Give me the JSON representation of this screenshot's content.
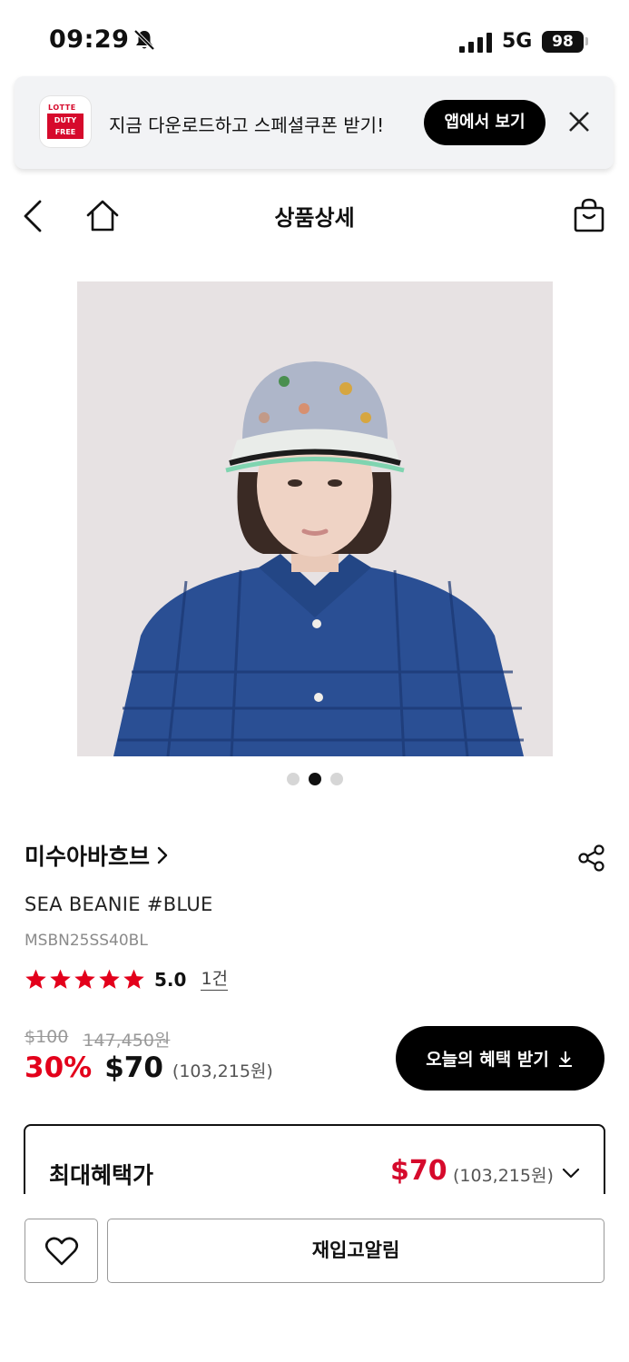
{
  "status_bar": {
    "time": "09:29",
    "network": "5G",
    "battery": "98"
  },
  "app_banner": {
    "logo_top": "LOTTE",
    "logo_line1": "DUTY",
    "logo_line2": "FREE",
    "text": "지금 다운로드하고 스페셜쿠폰 받기!",
    "button_label": "앱에서 보기"
  },
  "header": {
    "title": "상품상세"
  },
  "gallery": {
    "current_index": 2,
    "total": 3
  },
  "product": {
    "brand": "미수아바흐브",
    "name": "SEA BEANIE #BLUE",
    "code": "MSBN25SS40BL",
    "rating": {
      "stars": 5,
      "score": "5.0",
      "review_count": "1건"
    },
    "original_price_usd": "$100",
    "original_price_krw": "147,450원",
    "discount_rate": "30%",
    "price_usd": "$70",
    "price_krw": "(103,215원)",
    "benefit_button": "오늘의 혜택 받기"
  },
  "max_benefit": {
    "label": "최대혜택가",
    "price_usd": "$70",
    "price_krw": "(103,215원)"
  },
  "bottom_bar": {
    "restock_label": "재입고알림"
  },
  "colors": {
    "accent_red": "#e3001b",
    "brand_red": "#d60a2c",
    "black": "#000000"
  }
}
